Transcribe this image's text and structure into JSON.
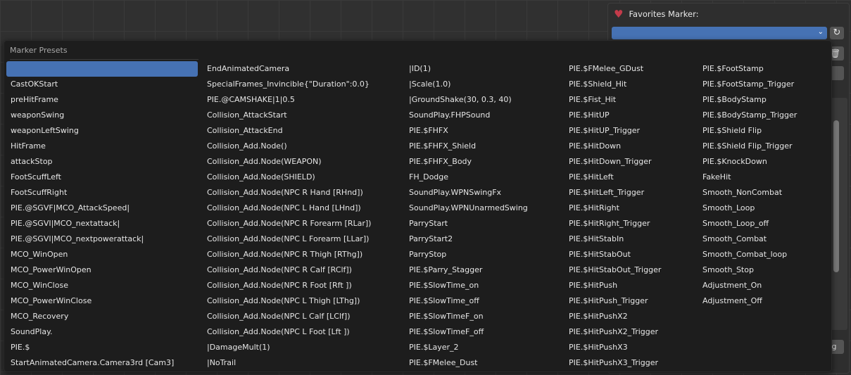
{
  "panel": {
    "favorites_label": "Favorites Marker:",
    "selected_value": "",
    "bottom_button_label": "ng"
  },
  "menu": {
    "title": "Marker Presets",
    "columns": [
      {
        "items": [
          "",
          "CastOKStart",
          "preHitFrame",
          "weaponSwing",
          "weaponLeftSwing",
          "HitFrame",
          "attackStop",
          "FootScuffLeft",
          "FootScuffRight",
          "PIE.@SGVF|MCO_AttackSpeed|",
          "PIE.@SGVI|MCO_nextattack|",
          "PIE.@SGVI|MCO_nextpowerattack|",
          "MCO_WinOpen",
          "MCO_PowerWinOpen",
          "MCO_WinClose",
          "MCO_PowerWinClose",
          "MCO_Recovery",
          "SoundPlay.",
          "PIE.$",
          "StartAnimatedCamera.Camera3rd [Cam3]"
        ]
      },
      {
        "items": [
          "EndAnimatedCamera",
          "SpecialFrames_Invincible{\"Duration\":0.0}",
          "PIE.@CAMSHAKE|1|0.5",
          "Collision_AttackStart",
          "Collision_AttackEnd",
          "Collision_Add.Node()",
          "Collision_Add.Node(WEAPON)",
          "Collision_Add.Node(SHIELD)",
          "Collision_Add.Node(NPC R Hand [RHnd])",
          "Collision_Add.Node(NPC L Hand [LHnd])",
          "Collision_Add.Node(NPC R Forearm [RLar])",
          "Collision_Add.Node(NPC L Forearm [LLar])",
          "Collision_Add.Node(NPC R Thigh [RThg])",
          "Collision_Add.Node(NPC R Calf [RClf])",
          "Collision_Add.Node(NPC R Foot [Rft ])",
          "Collision_Add.Node(NPC L Thigh [LThg])",
          "Collision_Add.Node(NPC L Calf [LClf])",
          "Collision_Add.Node(NPC L Foot [Lft ])",
          "|DamageMult(1)",
          "|NoTrail"
        ]
      },
      {
        "items": [
          "|ID(1)",
          "|Scale(1.0)",
          "|GroundShake(30, 0.3, 40)",
          "SoundPlay.FHPSound",
          "PIE.$FHFX",
          "PIE.$FHFX_Shield",
          "PIE.$FHFX_Body",
          "FH_Dodge",
          "SoundPlay.WPNSwingFx",
          "SoundPlay.WPNUnarmedSwing",
          "ParryStart",
          "ParryStart2",
          "ParryStop",
          "PIE.$Parry_Stagger",
          "PIE.$SlowTime_on",
          "PIE.$SlowTime_off",
          "PIE.$SlowTimeF_on",
          "PIE.$SlowTimeF_off",
          "PIE.$Layer_2",
          "PIE.$FMelee_Dust"
        ]
      },
      {
        "items": [
          "PIE.$FMelee_GDust",
          "PIE.$Shield_Hit",
          "PIE.$Fist_Hit",
          "PIE.$HitUP",
          "PIE.$HitUP_Trigger",
          "PIE.$HitDown",
          "PIE.$HitDown_Trigger",
          "PIE.$HitLeft",
          "PIE.$HitLeft_Trigger",
          "PIE.$HitRight",
          "PIE.$HitRight_Trigger",
          "PIE.$HitStabIn",
          "PIE.$HitStabOut",
          "PIE.$HitStabOut_Trigger",
          "PIE.$HitPush",
          "PIE.$HitPush_Trigger",
          "PIE.$HitPushX2",
          "PIE.$HitPushX2_Trigger",
          "PIE.$HitPushX3",
          "PIE.$HitPushX3_Trigger"
        ]
      },
      {
        "items": [
          "PIE.$FootStamp",
          "PIE.$FootStamp_Trigger",
          "PIE.$BodyStamp",
          "PIE.$BodyStamp_Trigger",
          "PIE.$Shield Flip",
          "PIE.$Shield Flip_Trigger",
          "PIE.$KnockDown",
          "FakeHit",
          "Smooth_NonCombat",
          "Smooth_Loop",
          "Smooth_Loop_off",
          "Smooth_Combat",
          "Smooth_Combat_loop",
          "Smooth_Stop",
          "Adjustment_On",
          "Adjustment_Off"
        ]
      }
    ]
  },
  "colors": {
    "accent": "#4672b4",
    "menu_bg": "#1d1d1d",
    "heart": "#c43b4a"
  },
  "icons": [
    "heart-icon",
    "chevron-down-icon",
    "refresh-icon",
    "trash-icon"
  ]
}
